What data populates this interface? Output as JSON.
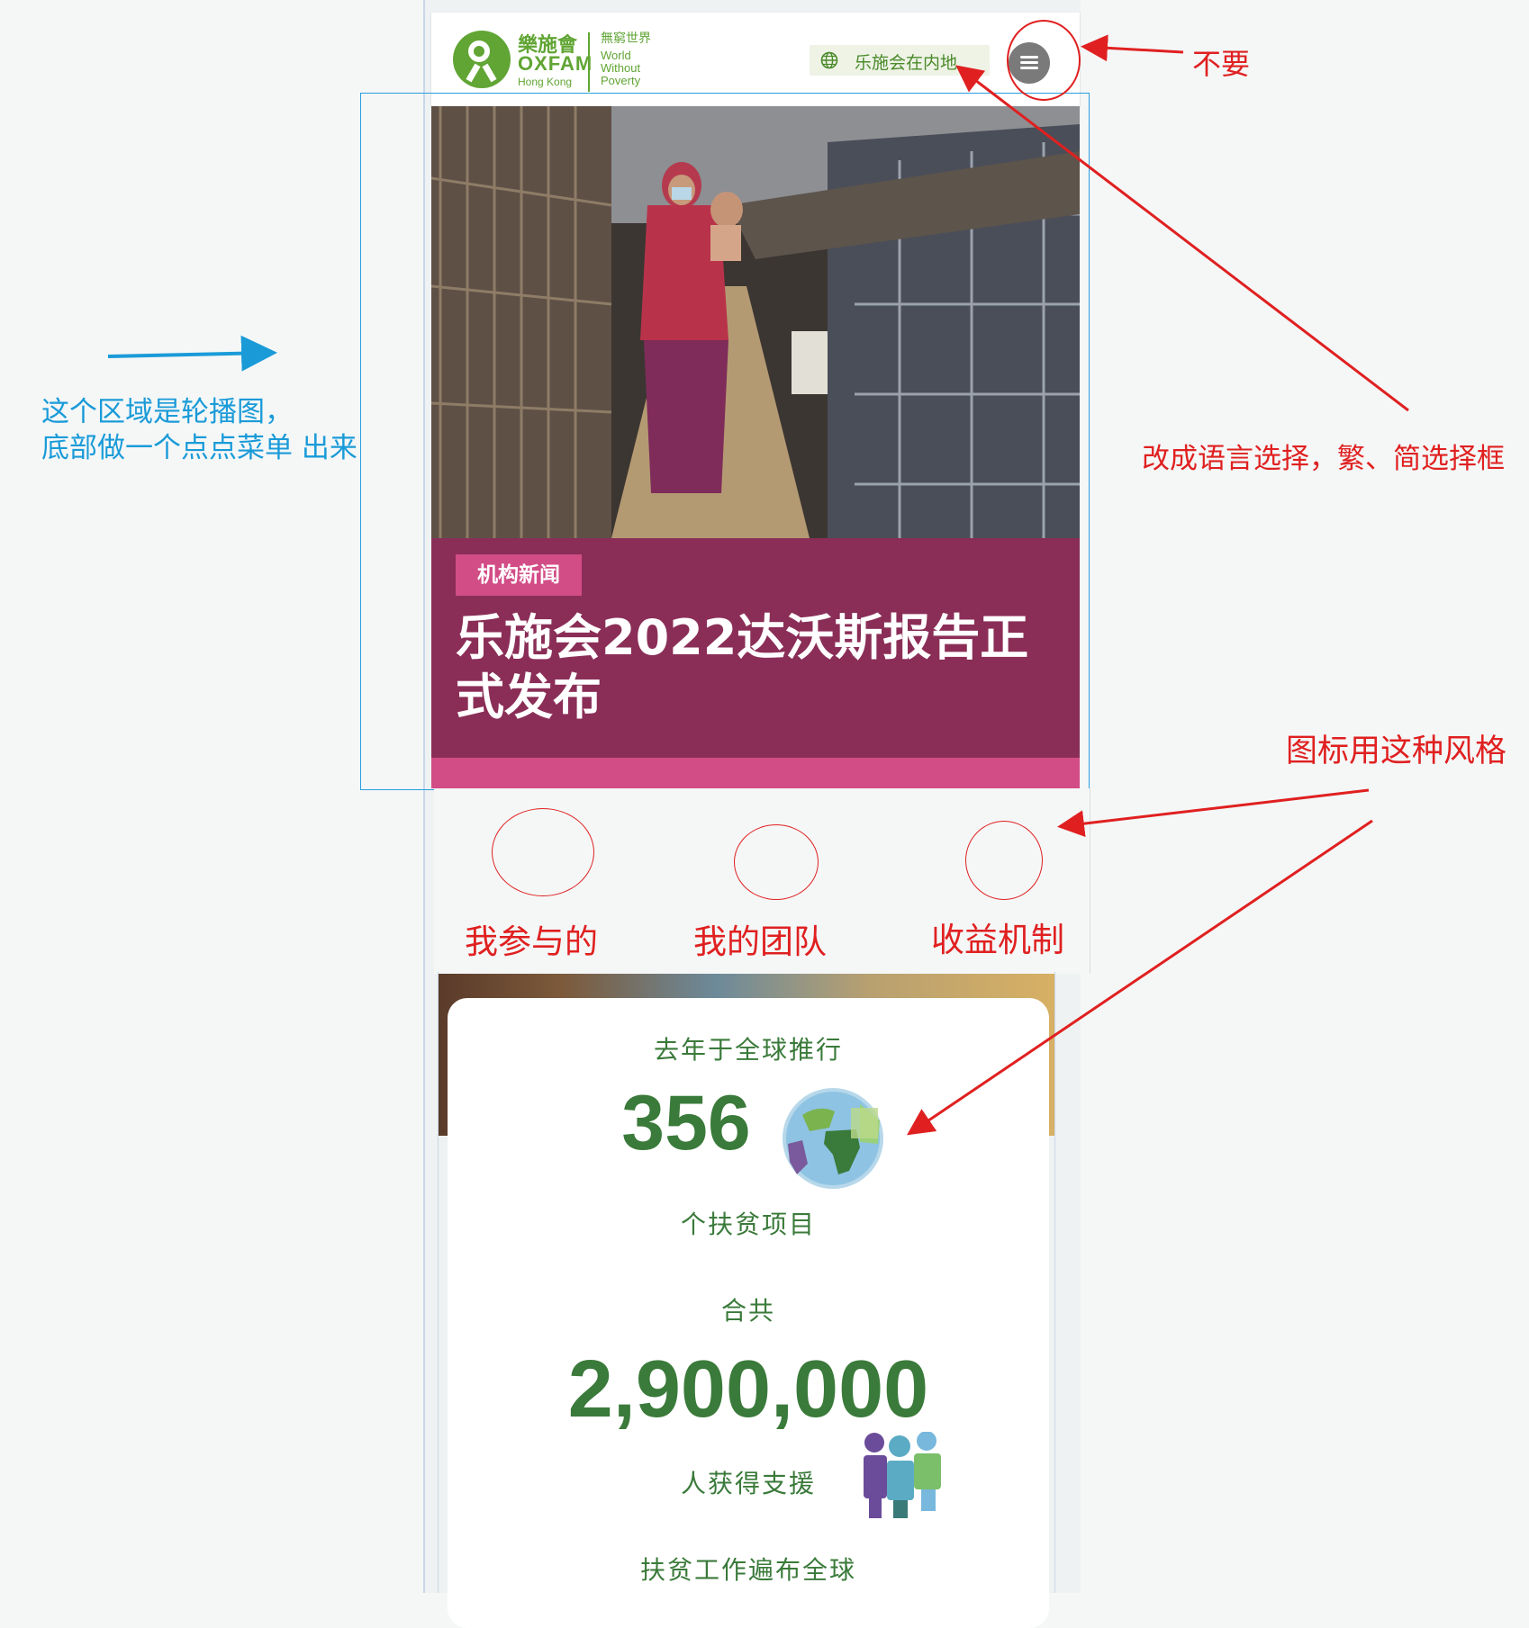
{
  "header": {
    "logo_cn": "樂施會",
    "logo_en": "OXFAM",
    "logo_sub": "Hong Kong",
    "tagline_cn": "無窮世界",
    "tagline_en": [
      "World",
      "Without",
      "Poverty"
    ],
    "lang_label": "乐施会在内地",
    "menu_icon": "hamburger-menu-icon"
  },
  "hero": {
    "tag": "机构新闻",
    "title": "乐施会2022达沃斯报告正式发布"
  },
  "features": [
    {
      "label": "我参与的"
    },
    {
      "label": "我的团队"
    },
    {
      "label": "收益机制"
    }
  ],
  "stats": {
    "intro": "去年于全球推行",
    "projects_count": "356",
    "projects_label": "个扶贫项目",
    "total_label": "合共",
    "people_count": "2,900,000",
    "people_label": "人获得支援",
    "global_label": "扶贫工作遍布全球"
  },
  "annotations": {
    "remove_note": "不要",
    "lang_note": "改成语言选择，繁、简选择框",
    "carousel_note_line1": "这个区域是轮播图，",
    "carousel_note_line2": "底部做一个点点菜单 出来",
    "icon_style_note": "图标用这种风格"
  },
  "colors": {
    "oxfam_green": "#61a534",
    "news_purple": "#8a2e57",
    "news_pink": "#d24c86",
    "stat_green": "#3a7a3a",
    "annotation_red": "#e02020",
    "annotation_blue": "#1a9bd8"
  }
}
